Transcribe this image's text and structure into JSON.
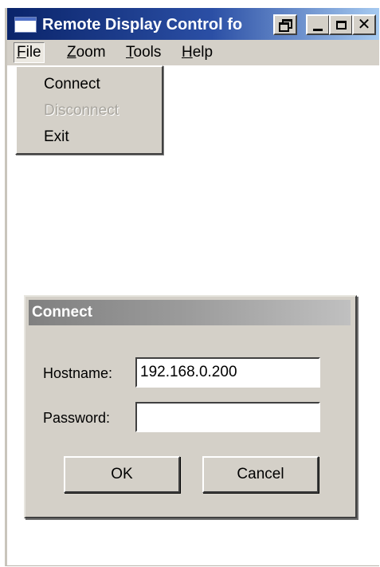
{
  "window": {
    "title": "Remote Display Control fo",
    "controls": [
      "restore-icon",
      "minimize-icon",
      "maximize-icon",
      "close-icon"
    ],
    "close_glyph": "✕"
  },
  "menubar": {
    "items": [
      {
        "label": "File"
      },
      {
        "label": "Zoom"
      },
      {
        "label": "Tools"
      },
      {
        "label": "Help"
      }
    ]
  },
  "file_menu": {
    "items": [
      {
        "label": "Connect",
        "enabled": true
      },
      {
        "label": "Disconnect",
        "enabled": false
      },
      {
        "label": "Exit",
        "enabled": true
      }
    ]
  },
  "connect_dialog": {
    "title": "Connect",
    "hostname_label": "Hostname:",
    "hostname_value": "192.168.0.200",
    "password_label": "Password:",
    "password_value": "",
    "ok_label": "OK",
    "cancel_label": "Cancel"
  },
  "colors": {
    "titlebar_start": "#0a246a",
    "titlebar_end": "#a6caf0",
    "face": "#d4d0c8",
    "disabled_text": "#a8a59e"
  }
}
